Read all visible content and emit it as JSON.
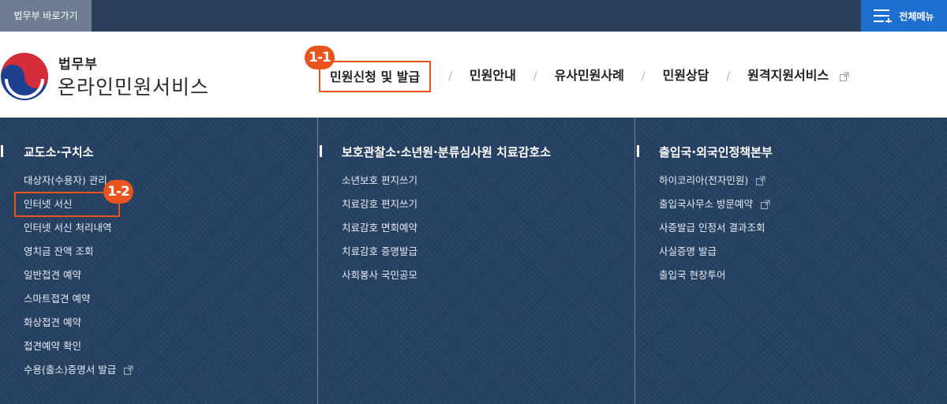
{
  "topbar": {
    "moj_link": "법무부 바로가기",
    "all_menu": "전체메뉴",
    "colors": {
      "bar": "#2b3f5c",
      "moj_link_bg": "#6e7d91",
      "all_menu_bg": "#1f6fd1"
    }
  },
  "header": {
    "logo_small": "법무부",
    "logo_big": "온라인민원서비스",
    "logo_icon": "taegeuk-logo-icon"
  },
  "gnb": {
    "items": [
      {
        "label": "민원신청 및 발급",
        "active": true
      },
      {
        "label": "민원안내"
      },
      {
        "label": "유사민원사례"
      },
      {
        "label": "민원상담"
      },
      {
        "label": "원격지원서비스",
        "external": true
      }
    ],
    "separator": "/"
  },
  "annotations": {
    "badge_1": "1-1",
    "badge_2": "1-2",
    "color": "#e8531e"
  },
  "mega": {
    "background": "#243e5f",
    "columns": [
      {
        "title": "교도소·구치소",
        "items": [
          {
            "label": "대상자(수용자) 관리"
          },
          {
            "label": "인터넷 서신",
            "highlighted": true
          },
          {
            "label": "인터넷 서신 처리내역"
          },
          {
            "label": "영치금 잔액 조회"
          },
          {
            "label": "일반접견 예약"
          },
          {
            "label": "스마트접견 예약"
          },
          {
            "label": "화상접견 예약"
          },
          {
            "label": "접견예약 확인"
          },
          {
            "label": "수용(출소)증명서 발급",
            "external": true
          }
        ]
      },
      {
        "title": "보호관찰소·소년원·분류심사원 치료감호소",
        "items": [
          {
            "label": "소년보호 편지쓰기"
          },
          {
            "label": "치료감호 편지쓰기"
          },
          {
            "label": "치료감호 면회예약"
          },
          {
            "label": "치료감호 증명발급"
          },
          {
            "label": "사회봉사 국민공모"
          }
        ]
      },
      {
        "title": "출입국·외국인정책본부",
        "items": [
          {
            "label": "하이코리아(전자민원)",
            "external": true
          },
          {
            "label": "출입국사무소 방문예약",
            "external": true
          },
          {
            "label": "사증발급 인정서 결과조회"
          },
          {
            "label": "사실증명 발급"
          },
          {
            "label": "출입국 현장투어"
          }
        ]
      }
    ]
  }
}
